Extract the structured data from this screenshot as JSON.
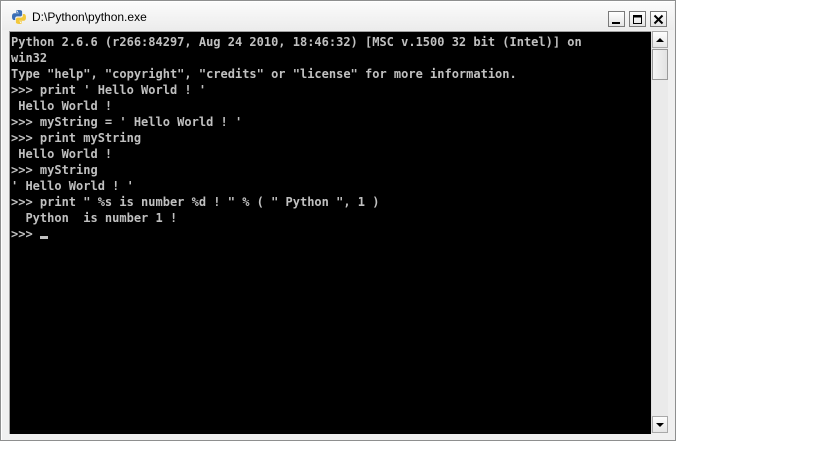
{
  "window": {
    "title": "D:\\Python\\python.exe",
    "controls": {
      "minimize": "minimize",
      "maximize": "maximize",
      "close": "close"
    }
  },
  "console": {
    "lines": [
      "Python 2.6.6 (r266:84297, Aug 24 2010, 18:46:32) [MSC v.1500 32 bit (Intel)] on",
      "win32",
      "Type \"help\", \"copyright\", \"credits\" or \"license\" for more information.",
      ">>> print ' Hello World ! '",
      " Hello World !",
      ">>> myString = ' Hello World ! '",
      ">>> print myString",
      " Hello World !",
      ">>> myString",
      "' Hello World ! '",
      ">>> print \" %s is number %d ! \" % ( \" Python \", 1 )",
      "  Python  is number 1 !"
    ],
    "prompt": ">>> "
  },
  "colors": {
    "console_bg": "#000000",
    "console_text": "#c0c0c0",
    "python_blue": "#3b6fb6",
    "python_yellow": "#f3c83b"
  },
  "icons": {
    "app": "python-icon",
    "minimize": "minimize-icon",
    "maximize": "maximize-icon",
    "close": "close-icon",
    "scroll_up": "scroll-up-arrow-icon",
    "scroll_down": "scroll-down-arrow-icon"
  }
}
